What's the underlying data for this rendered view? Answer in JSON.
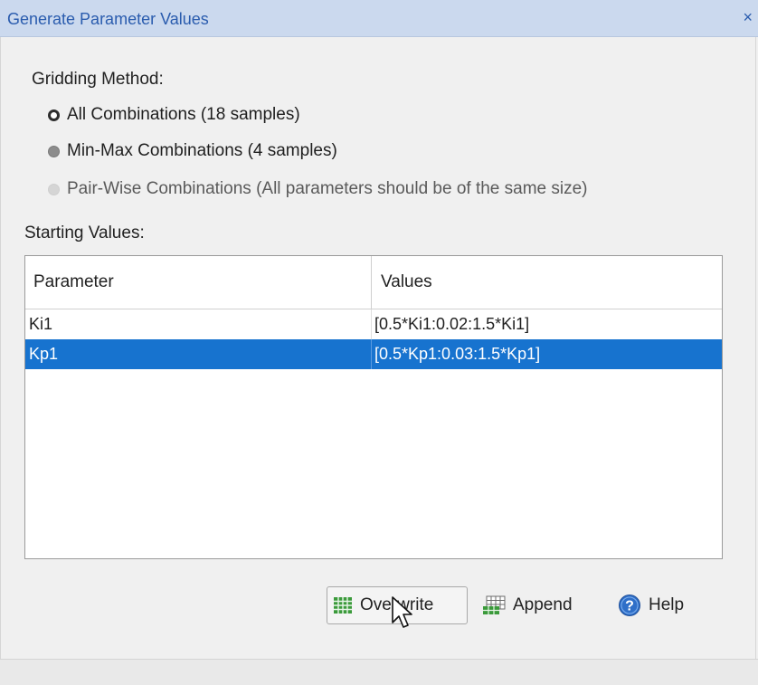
{
  "window": {
    "title": "Generate Parameter Values",
    "close_glyph": "×"
  },
  "gridding": {
    "label": "Gridding Method:",
    "options": [
      {
        "label": "All Combinations (18 samples)",
        "state": "checked"
      },
      {
        "label": "Min-Max Combinations (4 samples)",
        "state": "unchecked"
      },
      {
        "label": "Pair-Wise Combinations (All parameters should be of the same size)",
        "state": "disabled"
      }
    ]
  },
  "starting_values": {
    "label": "Starting Values:",
    "columns": [
      "Parameter",
      "Values"
    ],
    "rows": [
      {
        "parameter": "Ki1",
        "values": "[0.5*Ki1:0.02:1.5*Ki1]",
        "selected": false
      },
      {
        "parameter": "Kp1",
        "values": "[0.5*Kp1:0.03:1.5*Kp1]",
        "selected": true
      }
    ]
  },
  "buttons": {
    "overwrite": {
      "label": "Overwrite",
      "icon": "grid-table-icon"
    },
    "append": {
      "label": "Append",
      "icon": "grid-table-add-icon"
    },
    "help": {
      "label": "Help",
      "icon": "help-icon"
    }
  },
  "colors": {
    "title_bar": "#cbd9ee",
    "title_text": "#2a5cae",
    "selection": "#1773cf",
    "icon_green": "#3b9a3b",
    "help_blue": "#2f6fc8"
  }
}
